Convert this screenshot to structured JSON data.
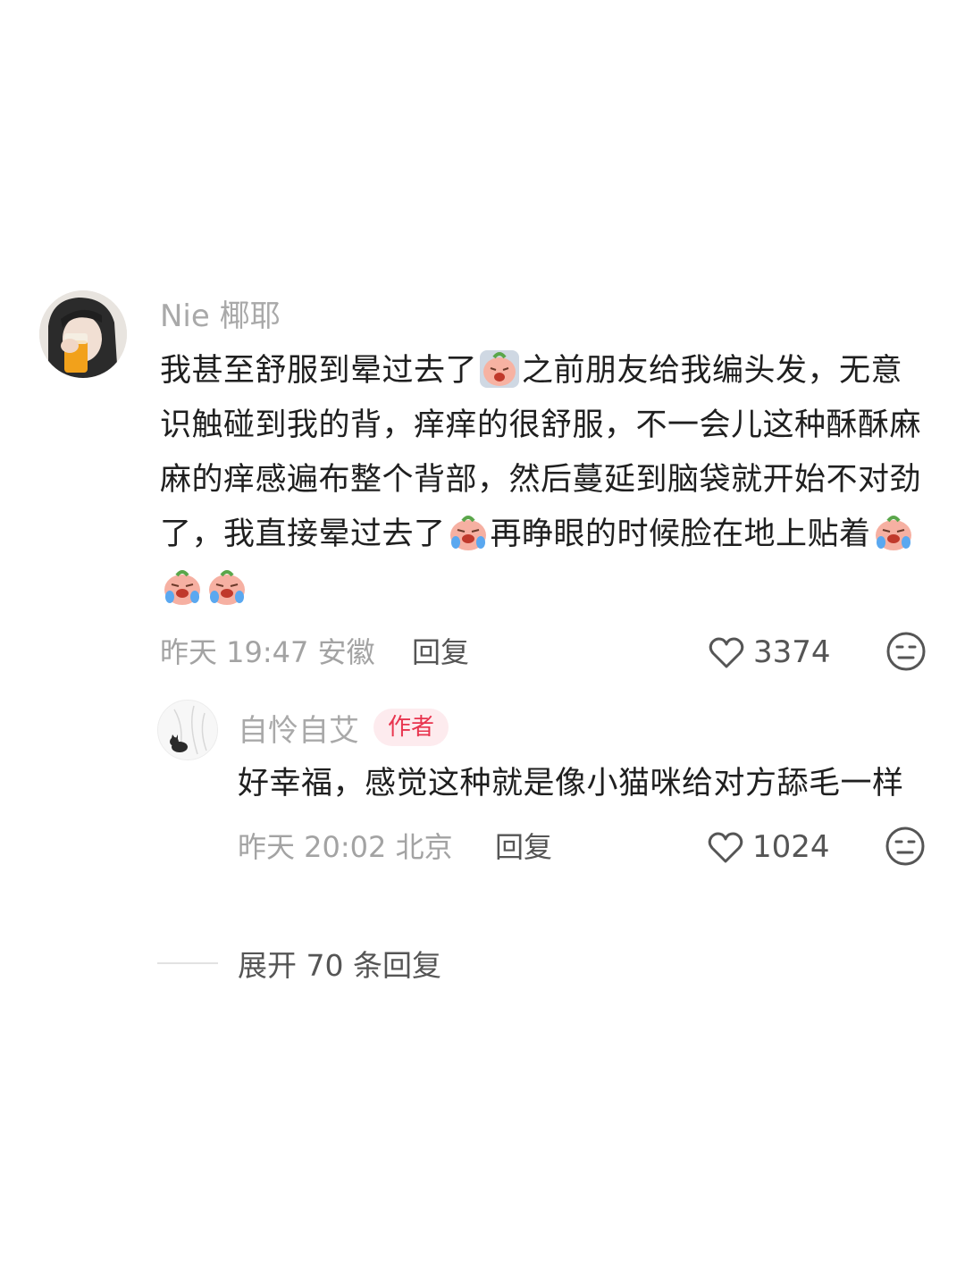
{
  "comment": {
    "username": "Nie 椰耶",
    "text_parts": [
      "我甚至舒服到晕过去了",
      "之前朋友给我编头发，无意识触碰到我的背，痒痒的很舒服，不一会儿这种酥酥麻麻的痒感遍布整个背部，然后蔓延到脑袋就开始不对劲了，我直接晕过去了",
      "再睁眼的时候脸在地上贴着"
    ],
    "emojis": [
      "crying-peach-emoji",
      "crying-peach-emoji",
      "crying-peach-emoji",
      "crying-peach-emoji",
      "crying-peach-emoji"
    ],
    "meta": "昨天 19:47 安徽",
    "reply_label": "回复",
    "likes": "3374"
  },
  "reply": {
    "username": "自怜自艾",
    "badge": "作者",
    "text": "好幸福，感觉这种就是像小猫咪给对方舔毛一样",
    "meta": "昨天 20:02 北京",
    "reply_label": "回复",
    "likes": "1024"
  },
  "expand": {
    "label": "展开 70 条回复"
  },
  "colors": {
    "accent": "#e8344e",
    "badge_bg": "#fdebee",
    "muted": "#a9a9a9",
    "text": "#1f1f1f"
  }
}
